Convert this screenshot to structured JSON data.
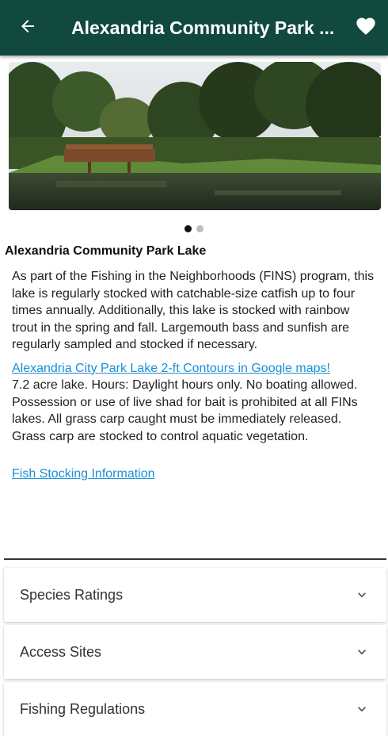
{
  "appbar": {
    "title": "Alexandria Community Park ...",
    "back_icon": "arrow-left-icon",
    "favorite_icon": "heart-icon",
    "background": "#11493f"
  },
  "carousel": {
    "image": "lake-photo",
    "page_count": 2,
    "current_page": 1
  },
  "lake": {
    "name": "Alexandria Community Park Lake",
    "description": "As part of the Fishing in the Neighborhoods (FINS) program, this lake is regularly stocked with catchable-size catfish up to four times annually. Additionally, this lake is stocked with rainbow trout in the spring and fall. Largemouth bass and sunfish are regularly sampled and stocked if necessary.",
    "map_link": "Alexandria City Park Lake 2-ft Contours in Google maps!",
    "notes": "7.2 acre lake. Hours: Daylight hours only. No boating allowed. Possession or use of live shad for bait is prohibited at all FINs lakes. All grass carp caught must be immediately released. Grass carp are stocked to control aquatic vegetation.",
    "stocking_link": "Fish Stocking Information",
    "link_color": "#1a8fd8"
  },
  "sections": [
    {
      "label": "Species Ratings",
      "icon": "chevron-down-icon"
    },
    {
      "label": "Access Sites",
      "icon": "chevron-down-icon"
    },
    {
      "label": "Fishing Regulations",
      "icon": "chevron-down-icon"
    }
  ]
}
